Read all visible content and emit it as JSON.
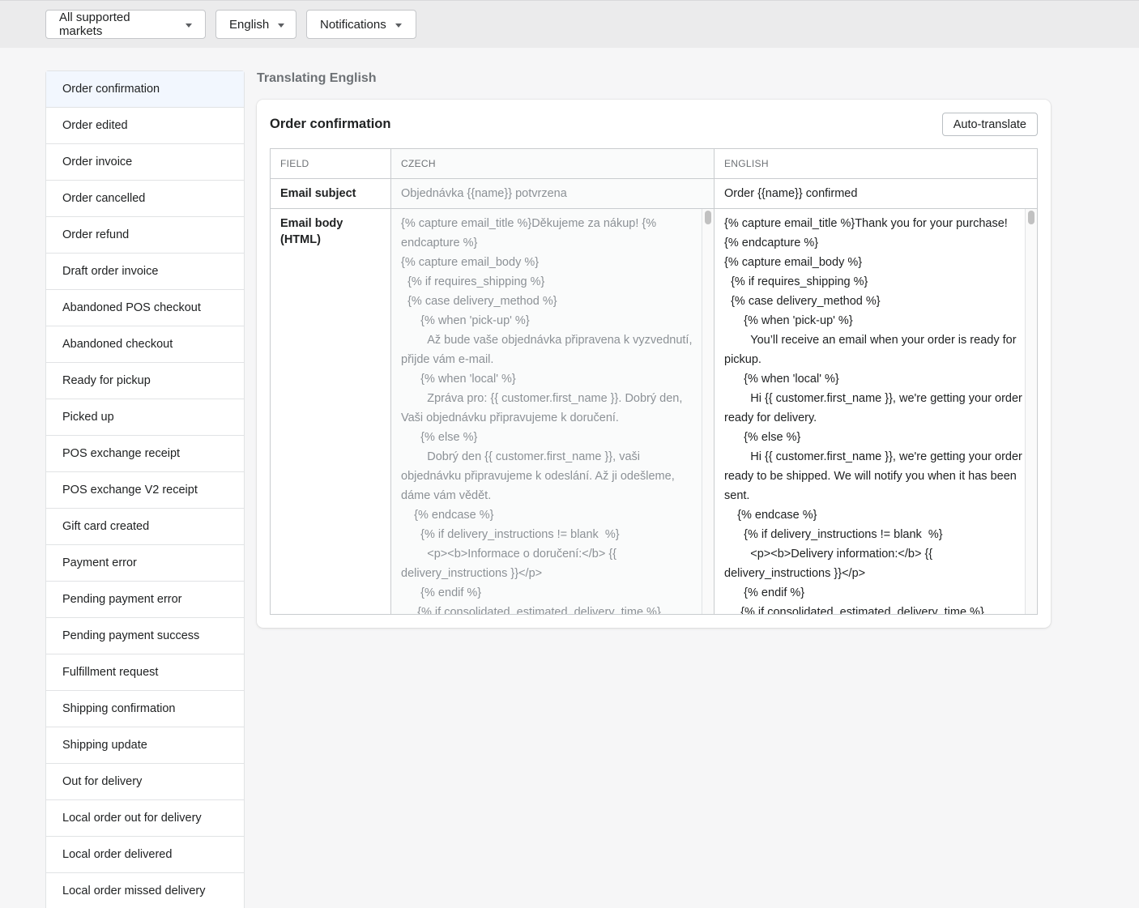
{
  "topbar": {
    "market_dropdown": "All supported markets",
    "language_dropdown": "English",
    "section_dropdown": "Notifications"
  },
  "sidebar": {
    "items": [
      {
        "label": "Order confirmation",
        "active": true
      },
      {
        "label": "Order edited"
      },
      {
        "label": "Order invoice"
      },
      {
        "label": "Order cancelled"
      },
      {
        "label": "Order refund"
      },
      {
        "label": "Draft order invoice"
      },
      {
        "label": "Abandoned POS checkout"
      },
      {
        "label": "Abandoned checkout"
      },
      {
        "label": "Ready for pickup"
      },
      {
        "label": "Picked up"
      },
      {
        "label": "POS exchange receipt"
      },
      {
        "label": "POS exchange V2 receipt"
      },
      {
        "label": "Gift card created"
      },
      {
        "label": "Payment error"
      },
      {
        "label": "Pending payment error"
      },
      {
        "label": "Pending payment success"
      },
      {
        "label": "Fulfillment request"
      },
      {
        "label": "Shipping confirmation"
      },
      {
        "label": "Shipping update"
      },
      {
        "label": "Out for delivery"
      },
      {
        "label": "Local order out for delivery"
      },
      {
        "label": "Local order delivered"
      },
      {
        "label": "Local order missed delivery"
      }
    ]
  },
  "main": {
    "heading": "Translating English",
    "card_title": "Order confirmation",
    "auto_translate_label": "Auto-translate",
    "table": {
      "headers": {
        "field": "FIELD",
        "source": "CZECH",
        "target": "ENGLISH"
      },
      "rows": [
        {
          "field": "Email subject",
          "source": "Objednávka {{name}} potvrzena",
          "target": "Order {{name}} confirmed"
        },
        {
          "field": "Email body (HTML)",
          "source": "{% capture email_title %}Děkujeme za nákup! {% endcapture %}\n{% capture email_body %}\n  {% if requires_shipping %}\n  {% case delivery_method %}\n      {% when 'pick-up' %}\n        Až bude vaše objednávka připravena k vyzvednutí, přijde vám e-mail.\n      {% when 'local' %}\n        Zpráva pro: {{ customer.first_name }}. Dobrý den, Vaši objednávku připravujeme k doručení.\n      {% else %}\n        Dobrý den {{ customer.first_name }}, vaši objednávku připravujeme k odeslání. Až ji odešleme, dáme vám vědět.\n    {% endcase %}\n      {% if delivery_instructions != blank  %}\n        <p><b>Informace o doručení:</b> {{ delivery_instructions }}</p>\n      {% endif %}\n     {% if consolidated_estimated_delivery_time %}",
          "target": "{% capture email_title %}Thank you for your purchase! {% endcapture %}\n{% capture email_body %}\n  {% if requires_shipping %}\n  {% case delivery_method %}\n      {% when 'pick-up' %}\n        You’ll receive an email when your order is ready for pickup.\n      {% when 'local' %}\n        Hi {{ customer.first_name }}, we're getting your order ready for delivery.\n      {% else %}\n        Hi {{ customer.first_name }}, we're getting your order ready to be shipped. We will notify you when it has been sent.\n    {% endcase %}\n      {% if delivery_instructions != blank  %}\n        <p><b>Delivery information:</b> {{ delivery_instructions }}</p>\n      {% endif %}\n     {% if consolidated_estimated_delivery_time %}"
        }
      ]
    }
  }
}
